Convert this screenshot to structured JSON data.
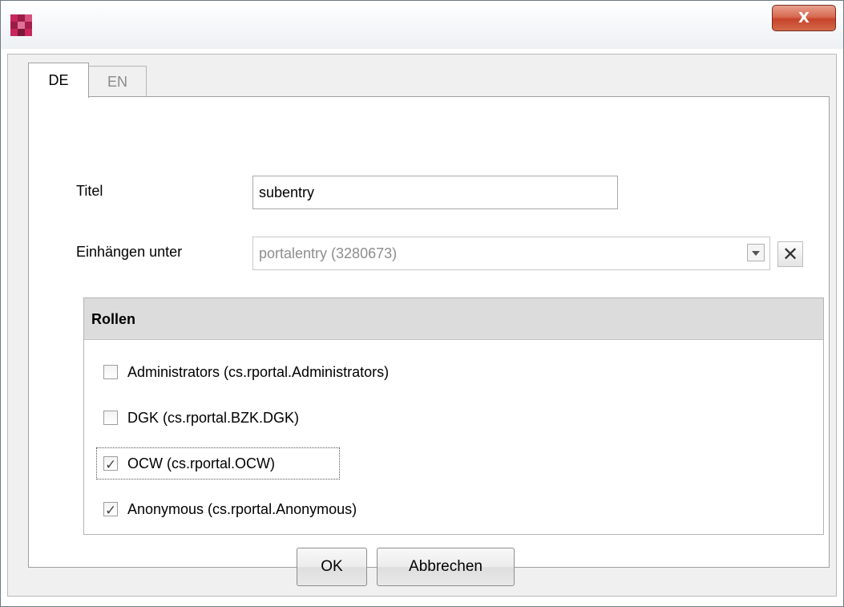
{
  "window": {
    "close_glyph": "X"
  },
  "tabs": [
    {
      "label": "DE",
      "active": true
    },
    {
      "label": "EN",
      "active": false
    }
  ],
  "form": {
    "title_label": "Titel",
    "title_value": "subentry",
    "parent_label": "Einhängen unter",
    "parent_value": "portalentry  (3280673)",
    "clear_glyph": "✕"
  },
  "roles": {
    "header": "Rollen",
    "items": [
      {
        "label": "Administrators   (cs.rportal.Administrators)",
        "checked": false
      },
      {
        "label": "DGK   (cs.rportal.BZK.DGK)",
        "checked": false
      },
      {
        "label": "OCW   (cs.rportal.OCW)",
        "checked": true
      },
      {
        "label": "Anonymous   (cs.rportal.Anonymous)",
        "checked": true
      }
    ]
  },
  "buttons": {
    "ok": "OK",
    "cancel": "Abbrechen"
  },
  "colors": {
    "close_button": "#c7432a",
    "logo": "#c8275d"
  }
}
